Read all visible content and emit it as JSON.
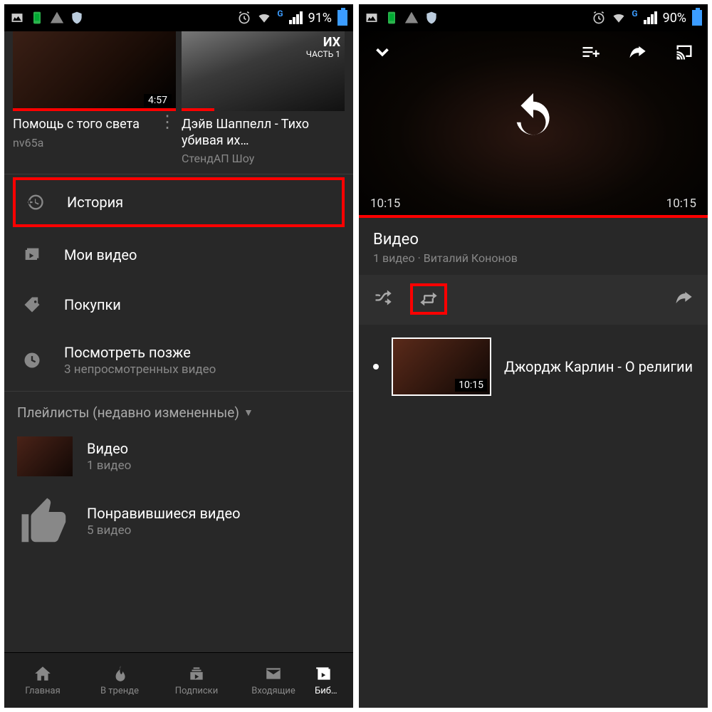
{
  "left": {
    "status": {
      "battery": "91%"
    },
    "videos": [
      {
        "title": "Помощь с того света",
        "channel": "nv65a",
        "duration": "4:57"
      },
      {
        "title": "Дэйв Шаппелл - Тихо убивая их…",
        "channel": "СтендАП Шоу",
        "overlay_top": "ИХ",
        "overlay_sub": "ЧАСТЬ 1"
      }
    ],
    "library": [
      {
        "label": "История"
      },
      {
        "label": "Мои видео"
      },
      {
        "label": "Покупки"
      },
      {
        "label": "Посмотреть позже",
        "sub": "3 непросмотренных видео"
      }
    ],
    "playlists_header": "Плейлисты (недавно измененные)",
    "playlists": [
      {
        "title": "Видео",
        "sub": "1 видео"
      },
      {
        "title": "Понравившиеся видео",
        "sub": "5 видео"
      }
    ],
    "nav": [
      {
        "label": "Главная"
      },
      {
        "label": "В тренде"
      },
      {
        "label": "Подписки"
      },
      {
        "label": "Входящие"
      },
      {
        "label": "Биб…"
      }
    ]
  },
  "right": {
    "status": {
      "battery": "90%"
    },
    "time_current": "10:15",
    "time_total": "10:15",
    "playlist": {
      "title": "Видео",
      "sub": "1 видео · Виталий Кононов"
    },
    "item": {
      "title": "Джордж Карлин - О религии",
      "duration": "10:15"
    }
  }
}
